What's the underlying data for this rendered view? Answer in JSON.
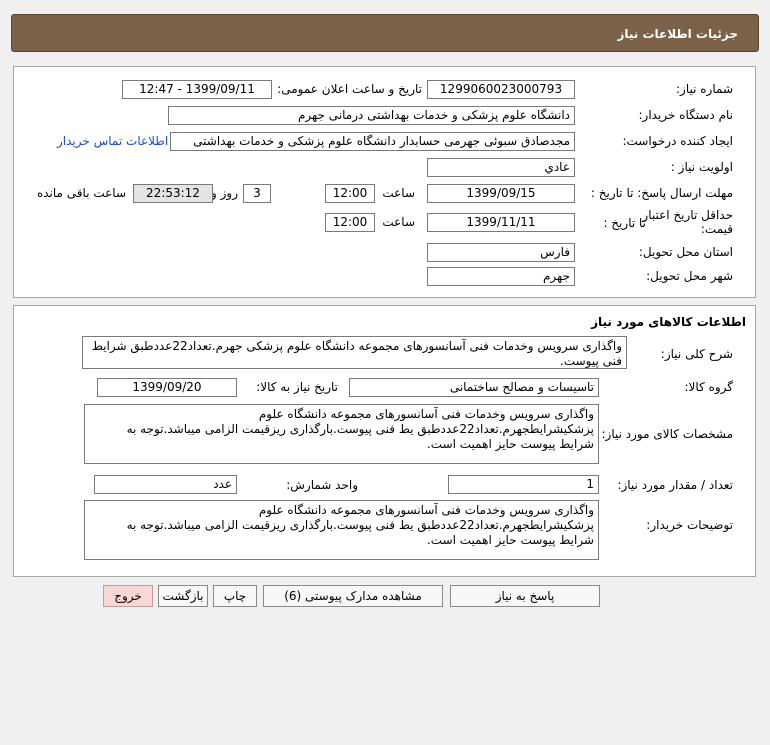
{
  "header": {
    "title": "جزئیات اطلاعات نیاز"
  },
  "general": {
    "need_number_label": "شماره نیاز:",
    "need_number": "1299060023000793",
    "announce_label": "تاریخ و ساعت اعلان عمومی:",
    "announce_value": "1399/09/11 - 12:47",
    "buyer_org_label": "نام دستگاه خریدار:",
    "buyer_org": "دانشگاه علوم پزشکی و خدمات بهداشتی درمانی جهرم",
    "requester_label": "ایجاد کننده درخواست:",
    "requester": "مجدصادق  سبوئی جهرمی حسابدار دانشگاه علوم پزشکی و خدمات بهداشتی",
    "contact_link": "اطلاعات تماس خریدار",
    "priority_label": "اولویت نیاز :",
    "priority": "عادي",
    "deadline_label": "مهلت ارسال پاسخ:  تا تاریخ :",
    "deadline_date": "1399/09/15",
    "time_label": "ساعت",
    "deadline_time": "12:00",
    "days_value": "3",
    "days_label": "روز و",
    "remaining_time": "22:53:12",
    "remaining_label": "ساعت باقی مانده",
    "validity_label_1": "حداقل تاریخ اعتبار",
    "validity_label_2": "قیمت:",
    "validity_to_label": "تا تاریخ :",
    "validity_date": "1399/11/11",
    "validity_time_label": "ساعت",
    "validity_time": "12:00",
    "province_label": "استان محل تحویل:",
    "province": "فارس",
    "city_label": "شهر محل تحویل:",
    "city": "جهرم"
  },
  "goods": {
    "section_title": "اطلاعات کالاهای مورد نیاز",
    "summary_label": "شرح کلی نیاز:",
    "summary": "واگذاری سرویس وخدمات فنی آسانسورهای مجموعه دانشگاه علوم پزشکی جهرم.تعداد22عددطبق شرایط فنی پیوست.",
    "group_label": "گروه کالا:",
    "group": "تاسیسات و مصالح ساختمانی",
    "need_date_label": "تاریخ نیاز به کالا:",
    "need_date": "1399/09/20",
    "specs_label": "مشخصات کالای مورد نیاز:",
    "specs": "واگذاری سرویس وخدمات فنی آسانسورهای مجموعه دانشگاه علوم پزشکیشرایطجهرم.تعداد22عددطبق یط فنی پیوست.بارگذاری ریزقیمت الزامی میباشد.توجه به شرایط پیوست حایز اهمیت است.",
    "qty_label": "تعداد / مقدار مورد نیاز:",
    "qty": "1",
    "unit_label": "واحد شمارش:",
    "unit": "عدد",
    "buyer_notes_label": "توضیحات خریدار:",
    "buyer_notes": "واگذاری سرویس وخدمات فنی آسانسورهای مجموعه دانشگاه علوم پزشکیشرایطجهرم.تعداد22عددطبق یط فنی پیوست.بارگذاری ریزقیمت الزامی میباشد.توجه به شرایط پیوست حایز اهمیت است."
  },
  "buttons": {
    "reply": "پاسخ به نیاز",
    "attachments": "مشاهده مدارک پیوستی (6)",
    "print": "چاپ",
    "back": "بازگشت",
    "exit": "خروج"
  }
}
